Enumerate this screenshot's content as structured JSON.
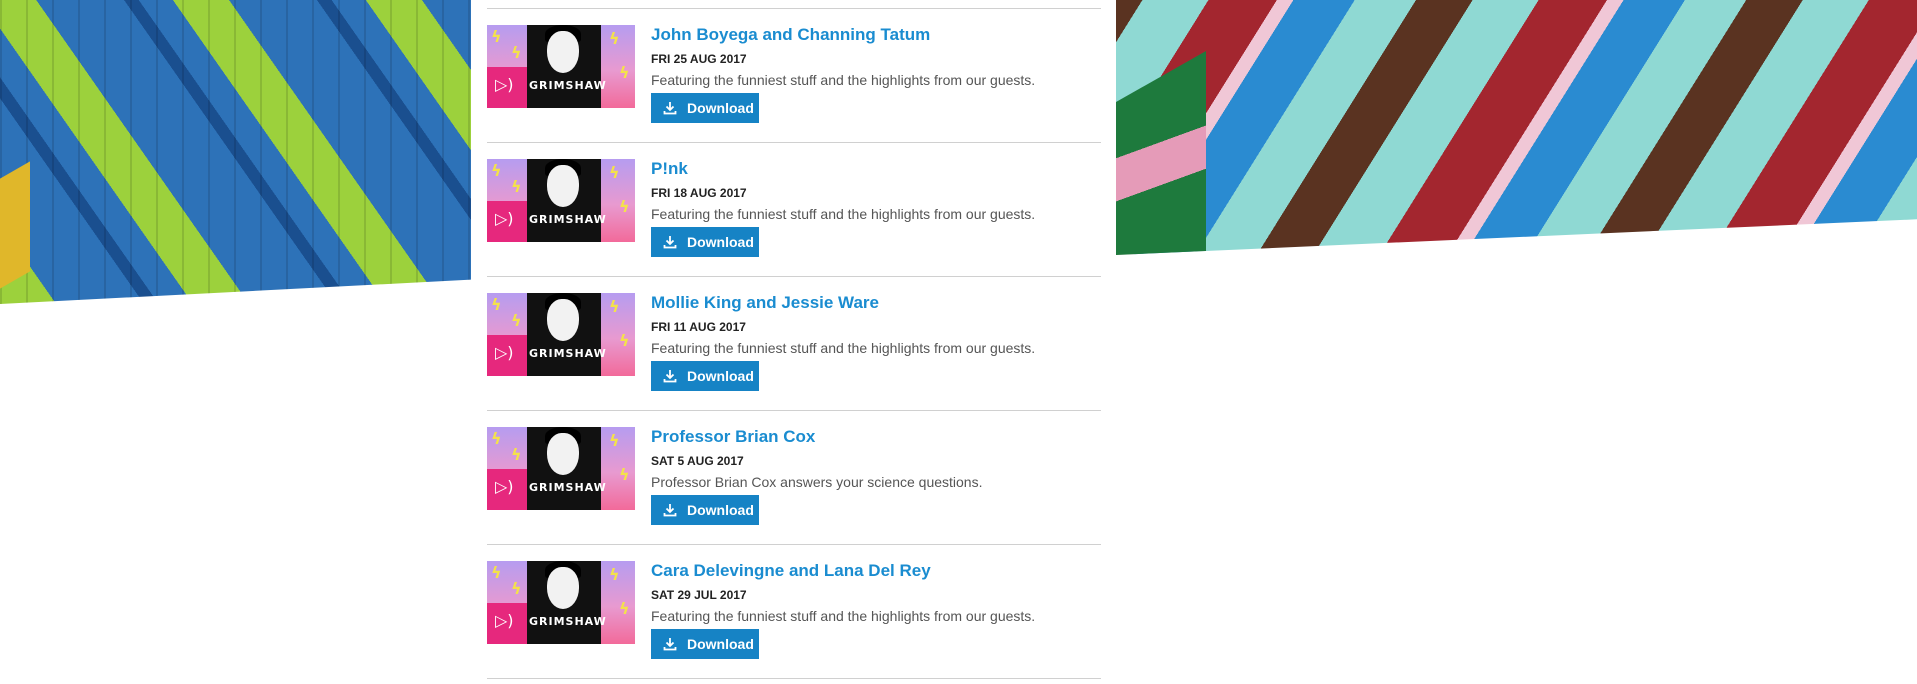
{
  "episodes": [
    {
      "title": "John Boyega and Channing Tatum",
      "date": "FRI 25 AUG 2017",
      "description": "Featuring the funniest stuff and the highlights from our guests.",
      "download_label": "Download"
    },
    {
      "title": "P!nk",
      "date": "FRI 18 AUG 2017",
      "description": "Featuring the funniest stuff and the highlights from our guests.",
      "download_label": "Download"
    },
    {
      "title": "Mollie King and Jessie Ware",
      "date": "FRI 11 AUG 2017",
      "description": "Featuring the funniest stuff and the highlights from our guests.",
      "download_label": "Download"
    },
    {
      "title": "Professor Brian Cox",
      "date": "SAT 5 AUG 2017",
      "description": "Professor Brian Cox answers your science questions.",
      "download_label": "Download"
    },
    {
      "title": "Cara Delevingne and Lana Del Rey",
      "date": "SAT 29 JUL 2017",
      "description": "Featuring the funniest stuff and the highlights from our guests.",
      "download_label": "Download"
    }
  ],
  "thumbnail": {
    "brand_text": "GRIMSHAW",
    "icon": "podcast-speaker-icon"
  },
  "colors": {
    "link": "#1a8cd0",
    "button": "#1683c5",
    "speaker": "#e6287d"
  }
}
